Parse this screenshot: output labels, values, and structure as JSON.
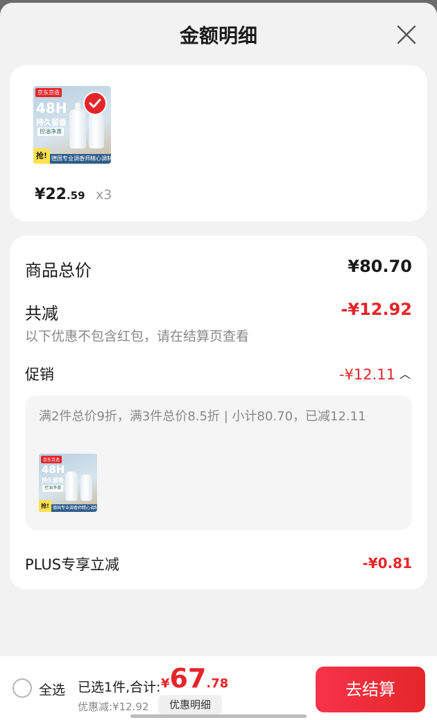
{
  "header": {
    "title": "金额明细"
  },
  "product": {
    "image_brand": "京东京造",
    "image_headline": "48H",
    "image_subline": "持久留香",
    "image_tag": "控油净澈",
    "image_strip": "德国专业调香师精心调制",
    "image_grab": "抢!",
    "price_symbol": "¥",
    "price_int": "22",
    "price_dec": ".59",
    "quantity": "x3"
  },
  "detail": {
    "total_label": "商品总价",
    "total_value": "¥80.70",
    "reduction_label": "共减",
    "reduction_value": "-¥12.92",
    "note": "以下优惠不包含红包，请在结算页查看",
    "promo_label": "促销",
    "promo_value": "-¥12.11",
    "promo_text": "满2件总价9折，满3件总价8.5折 | 小计80.70，已减12.11",
    "plus_label": "PLUS专享立减",
    "plus_value": "-¥0.81"
  },
  "footer": {
    "select_all": "全选",
    "summary": "已选1件,合计:",
    "total_symbol": "¥",
    "total_int": "67",
    "total_dec": ".78",
    "discount": "优惠减:¥12.92",
    "detail_button": "优惠明细",
    "checkout_button": "去结算"
  },
  "colors": {
    "accent_red": "#e4262a",
    "text_primary": "#1a1a1a",
    "text_secondary": "#888888"
  }
}
